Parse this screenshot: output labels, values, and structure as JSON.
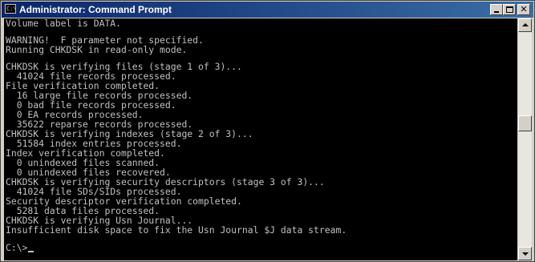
{
  "window": {
    "title": "Administrator: Command Prompt",
    "app_icon_text": "C:\\"
  },
  "console": {
    "lines": [
      "Volume label is DATA.",
      "",
      "WARNING!  F parameter not specified.",
      "Running CHKDSK in read-only mode.",
      "",
      "CHKDSK is verifying files (stage 1 of 3)...",
      "  41024 file records processed.",
      "File verification completed.",
      "  16 large file records processed.",
      "  0 bad file records processed.",
      "  0 EA records processed.",
      "  35622 reparse records processed.",
      "CHKDSK is verifying indexes (stage 2 of 3)...",
      "  51584 index entries processed.",
      "Index verification completed.",
      "  0 unindexed files scanned.",
      "  0 unindexed files recovered.",
      "CHKDSK is verifying security descriptors (stage 3 of 3)...",
      "  41024 file SDs/SIDs processed.",
      "Security descriptor verification completed.",
      "  5281 data files processed.",
      "CHKDSK is verifying Usn Journal...",
      "Insufficient disk space to fix the Usn Journal $J data stream."
    ],
    "prompt": "C:\\>",
    "text_color": "#c0c0c0",
    "background_color": "#000000"
  },
  "scrollbar": {
    "position_fraction": 0.42
  }
}
